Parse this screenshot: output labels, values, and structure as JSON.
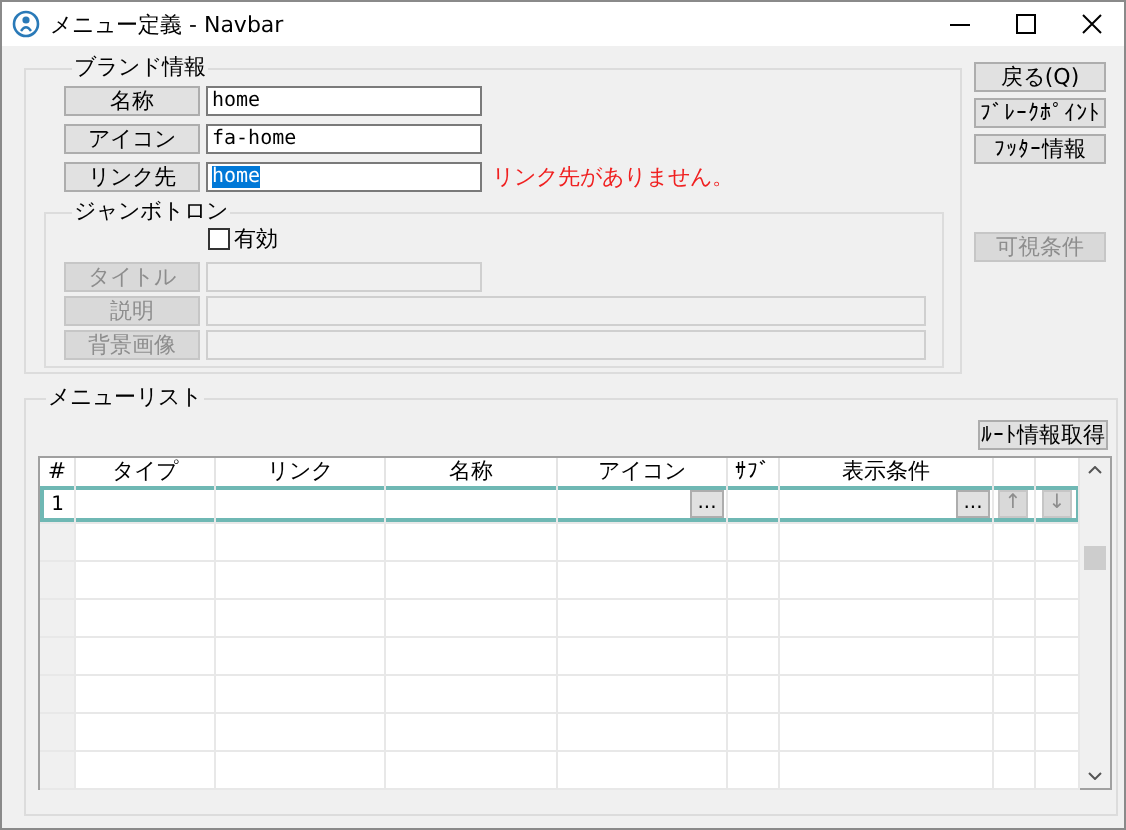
{
  "window": {
    "title": "メニュー定義 - Navbar"
  },
  "brand": {
    "legend": "ブランド情報",
    "fields": [
      {
        "label": "名称",
        "value": "home",
        "text_selected": false
      },
      {
        "label": "アイコン",
        "value": "fa-home",
        "text_selected": false
      },
      {
        "label": "リンク先",
        "value": "home",
        "text_selected": true
      }
    ],
    "error": "リンク先がありません。",
    "jumbotron": {
      "legend": "ジャンボトロン",
      "enabled": {
        "label": "有効",
        "checked": false
      },
      "fields": [
        {
          "label": "タイトル",
          "disabled": true
        },
        {
          "label": "説明",
          "disabled": true
        },
        {
          "label": "背景画像",
          "disabled": true
        }
      ]
    }
  },
  "side_buttons": [
    {
      "label": "戻る(Q)",
      "disabled": false
    },
    {
      "label": "ﾌﾞﾚｰｸﾎﾟｲﾝﾄ",
      "disabled": false
    },
    {
      "label": "ﾌｯﾀｰ情報",
      "disabled": false
    },
    {
      "label": "可視条件",
      "disabled": true
    }
  ],
  "menu_list": {
    "legend": "メニューリスト",
    "button": "ﾙｰﾄ情報取得",
    "columns": [
      "#",
      "タイプ",
      "リンク",
      "名称",
      "アイコン",
      "ｻﾌﾞ",
      "表示条件"
    ],
    "rows": [
      {
        "number": "1",
        "selected": true,
        "icon_button": "...",
        "condition_button": "...",
        "move_up": {
          "label": "↑",
          "disabled": true
        },
        "move_down": {
          "label": "↓",
          "disabled": true
        }
      }
    ]
  }
}
